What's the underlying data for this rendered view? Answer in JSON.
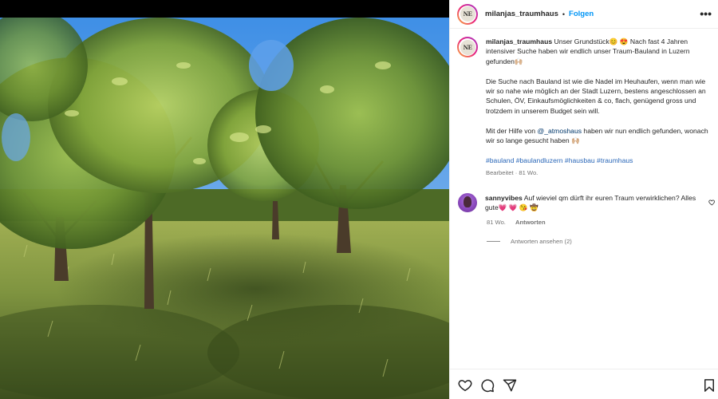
{
  "header": {
    "username": "milanjas_traumhaus",
    "separator": "•",
    "follow_label": "Folgen",
    "more_label": "•••",
    "avatar_text": "NE"
  },
  "caption": {
    "username": "milanjas_traumhaus",
    "p1": "Unser Grundstück😊 😍 Nach fast 4 Jahren intensiver Suche haben wir endlich unser Traum-Bauland in Luzern gefunden🙌🏼",
    "p2": "Die Suche nach Bauland ist wie die Nadel im Heuhaufen, wenn man wie wir so nahe wie möglich an der Stadt Luzern, bestens angeschlossen an Schulen, ÖV, Einkaufsmöglichkeiten & co, flach, genügend gross und trotzdem in unserem Budget sein will.",
    "p3_before": "Mit der Hilfe von ",
    "p3_mention": "@_atmoshaus",
    "p3_after": " haben wir nun endlich gefunden, wonach wir so lange gesucht haben 🙌🏼",
    "hashtags": "#bauland #baulandluzern #hausbau #traumhaus",
    "edited": "Bearbeitet · 81 Wo."
  },
  "comment": {
    "username": "sannyvibes",
    "text": "Auf wieviel qm dürft ihr euren Traum verwirklichen? Alles gute💗 💗 😘 🤠",
    "age": "81 Wo.",
    "reply_label": "Antworten",
    "view_replies": "Antworten ansehen (2)"
  },
  "icons": {
    "like": "heart-icon",
    "comment": "comment-icon",
    "share": "share-icon",
    "save": "bookmark-icon"
  },
  "colors": {
    "follow": "#0095f6",
    "hashtag": "#2a67b8",
    "muted": "#737373"
  }
}
